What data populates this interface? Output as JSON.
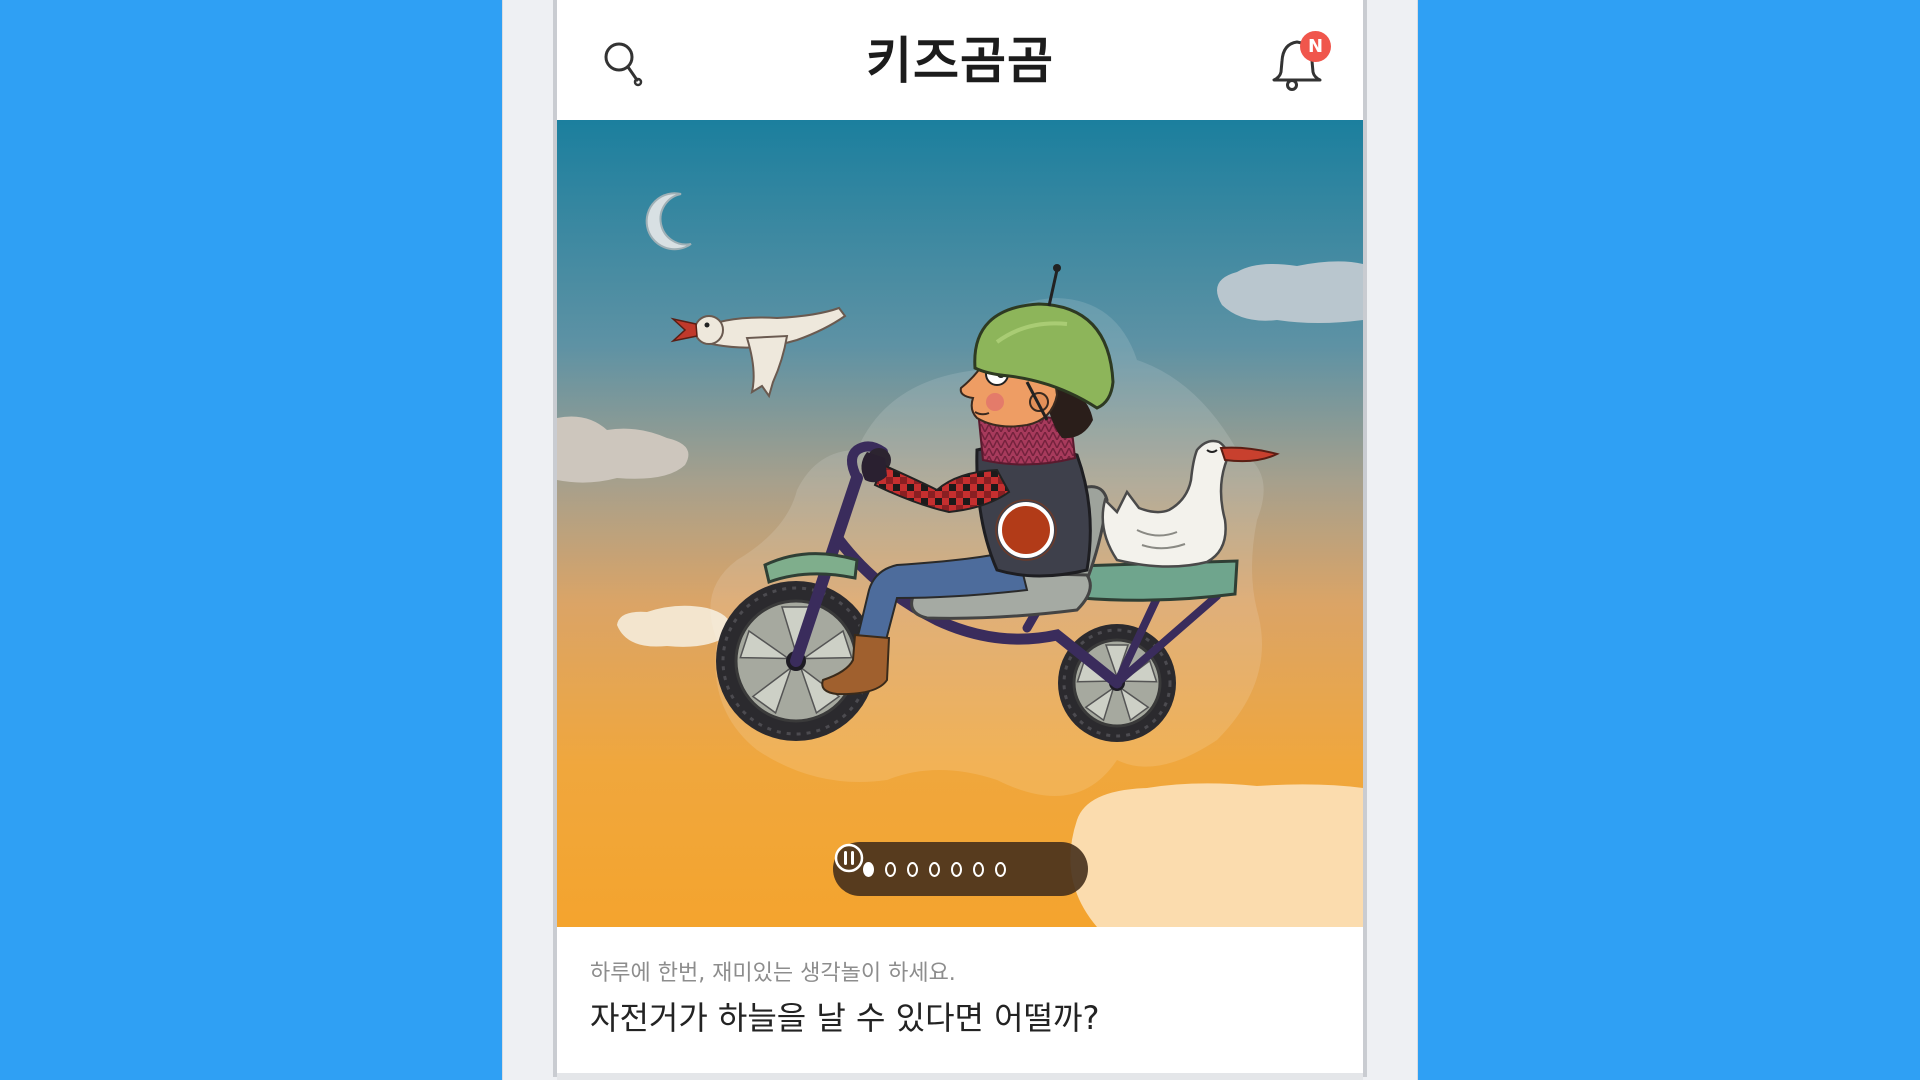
{
  "theme": {
    "background": "#2fa0f4",
    "badge_color": "#f0564c",
    "pager_color": "#46301c"
  },
  "icons": {
    "search": "search-icon",
    "notifications": "bell-icon",
    "pager_pause": "pause-icon"
  },
  "header": {
    "title": "키즈곰곰",
    "notification_badge": "N"
  },
  "carousel": {
    "slide_count": 7,
    "active_slide": 1
  },
  "card": {
    "subtitle": "하루에 한번, 재미있는 생각놀이 하세요.",
    "title": "자전거가 하늘을 날 수 있다면 어떨까?"
  }
}
